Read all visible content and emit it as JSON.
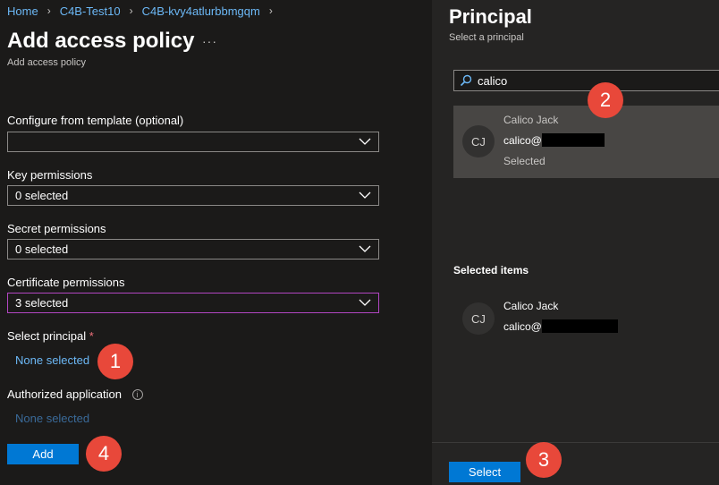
{
  "breadcrumb": {
    "items": [
      "Home",
      "C4B-Test10",
      "C4B-kvy4atlurbbmgqm"
    ]
  },
  "page": {
    "title": "Add access policy",
    "more": "···",
    "subtitle": "Add access policy"
  },
  "form": {
    "template": {
      "label": "Configure from template (optional)",
      "value": ""
    },
    "key_permissions": {
      "label": "Key permissions",
      "value": "0 selected"
    },
    "secret_permissions": {
      "label": "Secret permissions",
      "value": "0 selected"
    },
    "certificate_permissions": {
      "label": "Certificate permissions",
      "value": "3 selected"
    },
    "principal": {
      "label": "Select principal",
      "required_mark": "*",
      "link": "None selected"
    },
    "authorized_application": {
      "label": "Authorized application",
      "info": "i",
      "link": "None selected"
    },
    "add_label": "Add"
  },
  "principal_panel": {
    "title": "Principal",
    "subtitle": "Select a principal",
    "search": {
      "value": "calico",
      "icon": "search-icon"
    },
    "result": {
      "initials": "CJ",
      "name": "Calico Jack",
      "email_prefix": "calico@",
      "status": "Selected"
    },
    "selected_items_title": "Selected items",
    "selected_item": {
      "initials": "CJ",
      "name": "Calico Jack",
      "email_prefix": "calico@"
    },
    "select_label": "Select"
  },
  "badges": [
    "1",
    "2",
    "3",
    "4"
  ],
  "colors": {
    "accent": "#0078d4",
    "link": "#6cb8f6",
    "badge": "#e8483a",
    "focus_border": "#b146c2",
    "required": "#f1707b"
  }
}
